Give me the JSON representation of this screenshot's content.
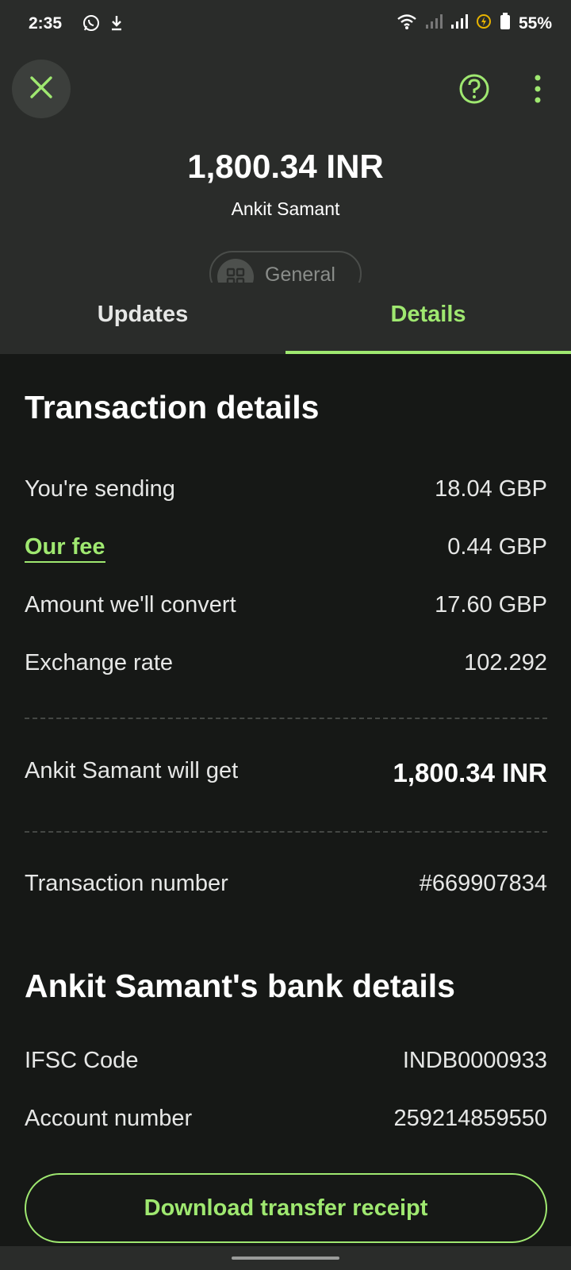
{
  "status_bar": {
    "time": "2:35",
    "battery": "55%",
    "icons": [
      "whatsapp-icon",
      "download-icon",
      "wifi-icon",
      "signal-icon",
      "signal-icon",
      "battery-saver-icon",
      "battery-icon"
    ]
  },
  "header": {
    "amount": "1,800.34 INR",
    "recipient": "Ankit Samant",
    "category": "General",
    "tabs": [
      {
        "label": "Updates",
        "active": false
      },
      {
        "label": "Details",
        "active": true
      }
    ]
  },
  "transaction": {
    "title": "Transaction details",
    "rows": [
      {
        "label": "You're sending",
        "value": "18.04 GBP"
      },
      {
        "label": "Our fee",
        "value": "0.44 GBP"
      },
      {
        "label": "Amount we'll convert",
        "value": "17.60 GBP"
      },
      {
        "label": "Exchange rate",
        "value": "102.292"
      }
    ],
    "receive_label": "Ankit Samant will get",
    "receive_value": "1,800.34 INR",
    "number_label": "Transaction number",
    "number_value": "#669907834"
  },
  "bank": {
    "title": "Ankit Samant's bank details",
    "rows": [
      {
        "label": "IFSC Code",
        "value": "INDB0000933"
      },
      {
        "label": "Account number",
        "value": "259214859550"
      }
    ]
  },
  "actions": {
    "download_label": "Download transfer receipt"
  },
  "colors": {
    "accent": "#9fe870",
    "background": "#161816",
    "header_bg": "#2a2c2a"
  }
}
